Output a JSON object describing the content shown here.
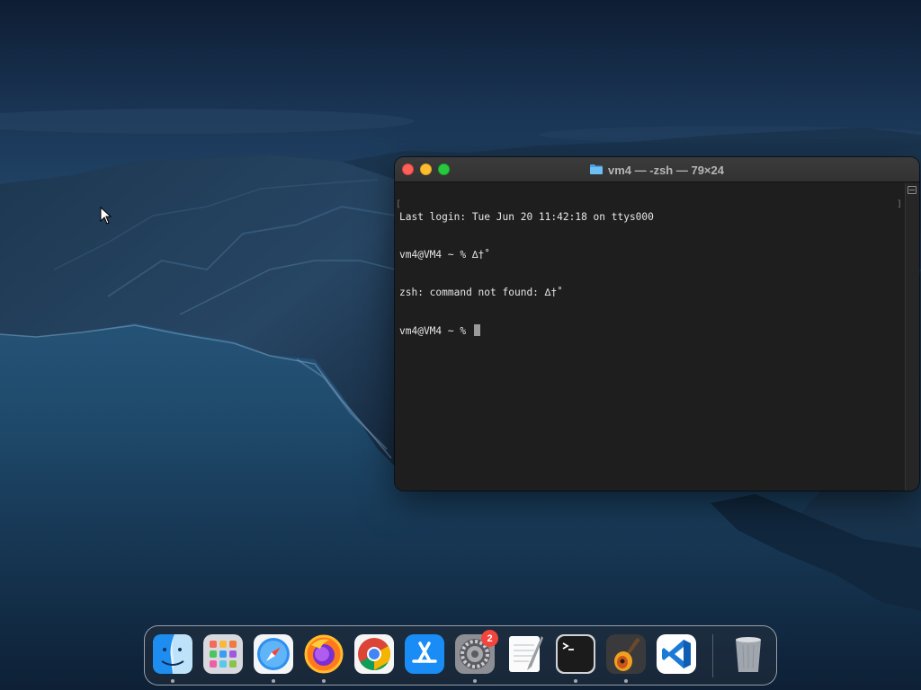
{
  "desktop": {
    "wallpaper": "Catalina coastal island at dusk"
  },
  "terminal": {
    "title": "vm4 — -zsh — 79×24",
    "lines": [
      "Last login: Tue Jun 20 11:42:18 on ttys000",
      "vm4@VM4 ~ % ∆†˚",
      "zsh: command not found: ∆†˚",
      "vm4@VM4 ~ % "
    ],
    "colors": {
      "background": "#1e1e1e",
      "text": "#e6e6e6",
      "close": "#fe5f57",
      "minimize": "#febc2e",
      "zoom": "#28c840"
    }
  },
  "dock": {
    "items": [
      {
        "name": "Finder",
        "icon": "finder-icon",
        "running": true
      },
      {
        "name": "Launchpad",
        "icon": "launchpad-icon",
        "running": false
      },
      {
        "name": "Safari",
        "icon": "safari-icon",
        "running": true
      },
      {
        "name": "Firefox",
        "icon": "firefox-icon",
        "running": true
      },
      {
        "name": "Google Chrome",
        "icon": "chrome-icon",
        "running": false
      },
      {
        "name": "App Store",
        "icon": "app-store-icon",
        "running": false
      },
      {
        "name": "System Settings",
        "icon": "system-settings-icon",
        "running": true,
        "badge": "2"
      },
      {
        "name": "TextEdit",
        "icon": "textedit-icon",
        "running": false
      },
      {
        "name": "Terminal",
        "icon": "terminal-icon",
        "running": true
      },
      {
        "name": "GarageBand",
        "icon": "garageband-icon",
        "running": true
      },
      {
        "name": "Visual Studio Code",
        "icon": "vscode-icon",
        "running": false
      },
      {
        "name": "Trash",
        "icon": "trash-icon",
        "running": false
      }
    ],
    "badge_color": "#f1453d"
  }
}
